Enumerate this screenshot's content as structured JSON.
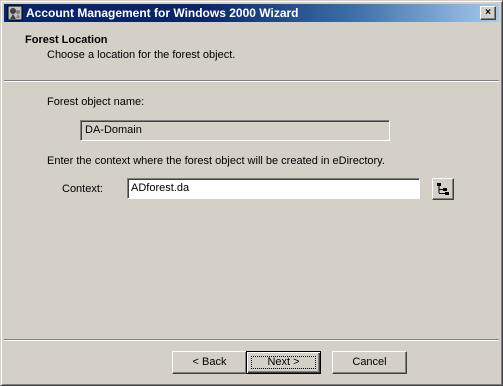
{
  "window": {
    "title": "Account Management for Windows 2000 Wizard",
    "close_glyph": "×"
  },
  "header": {
    "title": "Forest Location",
    "subtitle": "Choose a location for the forest object."
  },
  "form": {
    "forest_name_label": "Forest object name:",
    "forest_name_value": "DA-Domain",
    "context_instruction": "Enter the context where the forest object will be created in eDirectory.",
    "context_label": "Context:",
    "context_value": "ADforest.da"
  },
  "buttons": {
    "back_label": "< Back",
    "next_label": "Next >",
    "cancel_label": "Cancel",
    "default": "next"
  },
  "icons": {
    "title": "wizard-app-icon",
    "browse": "tree-browse-icon"
  }
}
